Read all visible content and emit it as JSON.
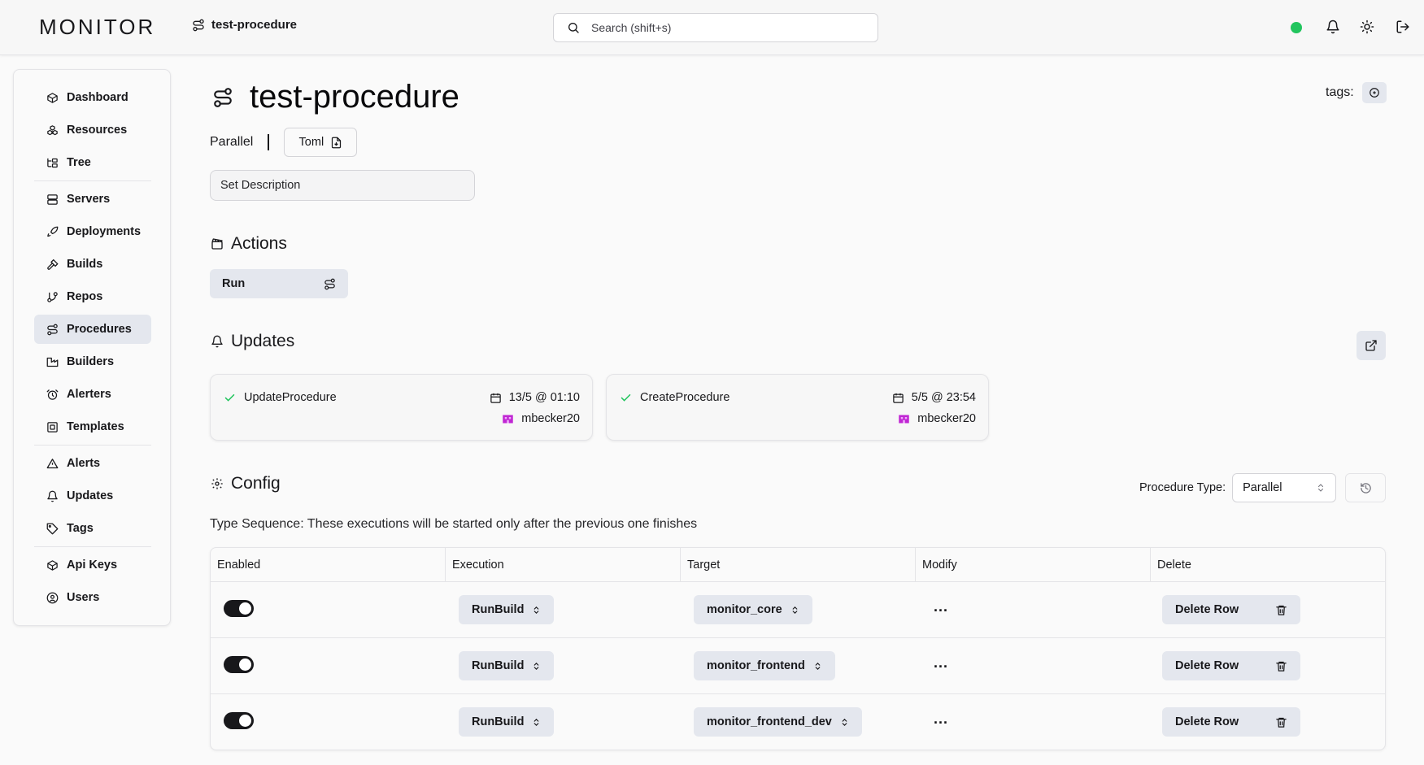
{
  "app": {
    "logo": "MONITOR"
  },
  "breadcrumb": {
    "label": "test-procedure",
    "icon": "route-icon"
  },
  "search": {
    "placeholder": "Search (shift+s)"
  },
  "status": {
    "color": "#22c55e"
  },
  "sidebar": {
    "items": [
      {
        "label": "Dashboard",
        "icon": "box-icon"
      },
      {
        "label": "Resources",
        "icon": "boxes-icon"
      },
      {
        "label": "Tree",
        "icon": "folder-tree-icon"
      },
      {
        "label": "Servers",
        "icon": "server-icon"
      },
      {
        "label": "Deployments",
        "icon": "rocket-icon"
      },
      {
        "label": "Builds",
        "icon": "hammer-icon"
      },
      {
        "label": "Repos",
        "icon": "git-branch-icon"
      },
      {
        "label": "Procedures",
        "icon": "route-icon",
        "active": true
      },
      {
        "label": "Builders",
        "icon": "factory-icon"
      },
      {
        "label": "Alerters",
        "icon": "alarm-clock-icon"
      },
      {
        "label": "Templates",
        "icon": "scan-icon"
      },
      {
        "label": "Alerts",
        "icon": "alert-triangle-icon"
      },
      {
        "label": "Updates",
        "icon": "bell-icon"
      },
      {
        "label": "Tags",
        "icon": "tag-icon"
      },
      {
        "label": "Api Keys",
        "icon": "box-icon"
      },
      {
        "label": "Users",
        "icon": "user-circle-icon"
      }
    ]
  },
  "page": {
    "title": "test-procedure",
    "tags_label": "tags:",
    "procedure_kind": "Parallel",
    "toml_label": "Toml",
    "description_placeholder": "Set Description"
  },
  "actions": {
    "title": "Actions",
    "run_label": "Run"
  },
  "updates": {
    "title": "Updates",
    "cards": [
      {
        "operation": "UpdateProcedure",
        "time": "13/5 @ 01:10",
        "user": "mbecker20"
      },
      {
        "operation": "CreateProcedure",
        "time": "5/5 @ 23:54",
        "user": "mbecker20"
      }
    ]
  },
  "config": {
    "title": "Config",
    "procedure_type_label": "Procedure Type:",
    "procedure_type_value": "Parallel",
    "type_description": "Type Sequence: These executions will be started only after the previous one finishes",
    "columns": [
      "Enabled",
      "Execution",
      "Target",
      "Modify",
      "Delete"
    ],
    "rows": [
      {
        "enabled": true,
        "execution": "RunBuild",
        "target": "monitor_core",
        "modify": "...",
        "delete_label": "Delete Row"
      },
      {
        "enabled": true,
        "execution": "RunBuild",
        "target": "monitor_frontend",
        "modify": "...",
        "delete_label": "Delete Row"
      },
      {
        "enabled": true,
        "execution": "RunBuild",
        "target": "monitor_frontend_dev",
        "modify": "...",
        "delete_label": "Delete Row"
      }
    ]
  },
  "colors": {
    "accent_bg": "#e4e7ee",
    "success": "#22c55e",
    "user_icon": "#c026d3"
  }
}
